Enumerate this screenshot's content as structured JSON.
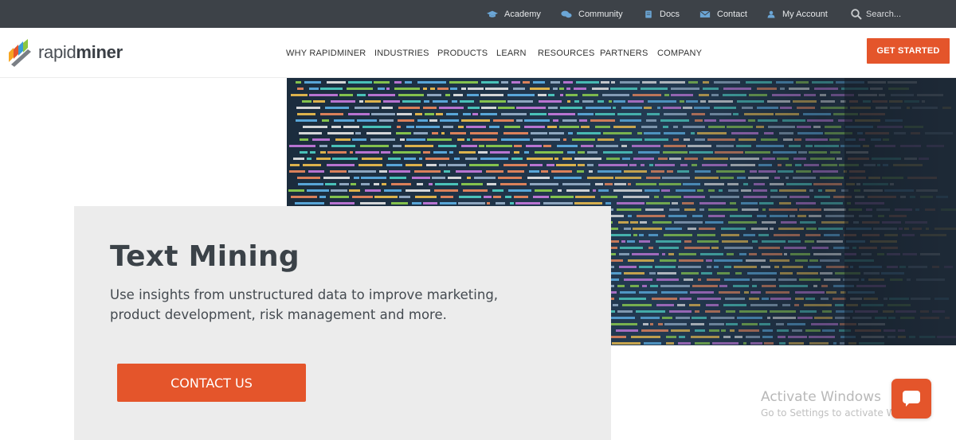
{
  "topbar": {
    "links": [
      {
        "label": "Academy",
        "icon": "graduation-cap-icon"
      },
      {
        "label": "Community",
        "icon": "chat-bubbles-icon"
      },
      {
        "label": "Docs",
        "icon": "document-icon"
      },
      {
        "label": "Contact",
        "icon": "envelope-icon"
      },
      {
        "label": "My Account",
        "icon": "user-icon"
      }
    ],
    "search_placeholder": "Search..."
  },
  "header": {
    "logo_text_light": "rapid",
    "logo_text_bold": "miner",
    "nav": [
      "WHY RAPIDMINER",
      "INDUSTRIES",
      "PRODUCTS",
      "LEARN",
      "RESOURCES",
      "PARTNERS",
      "COMPANY"
    ],
    "cta_label": "GET STARTED"
  },
  "hero": {
    "title": "Text Mining",
    "subtitle": "Use insights from unstructured data to improve marketing, product development, risk management and more.",
    "button_label": "CONTACT US"
  },
  "watermark": {
    "line1": "Activate Windows",
    "line2": "Go to Settings to activate Windows."
  },
  "colors": {
    "accent": "#e4552b",
    "topbar": "#3d4248",
    "card": "#ececec"
  }
}
